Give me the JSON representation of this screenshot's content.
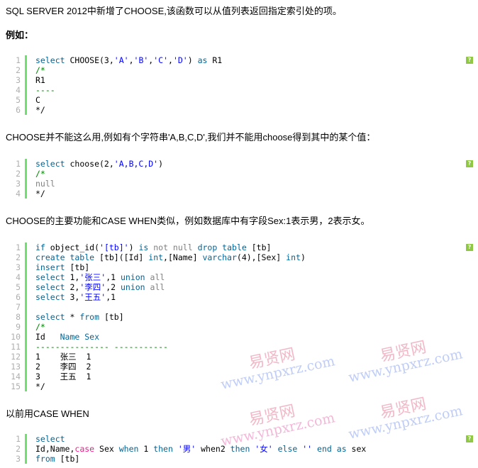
{
  "paragraphs": [
    "SQL SERVER 2012中新增了CHOOSE,该函数可以从值列表返回指定索引处的项。",
    "例如：",
    "CHOOSE并不能这么用,例如有个字符串'A,B,C,D',我们并不能用choose得到其中的某个值：",
    "CHOOSE的主要功能和CASE WHEN类似，例如数据库中有字段Sex:1表示男，2表示女。",
    "以前用CASE WHEN"
  ],
  "help_label": "?",
  "code_blocks": [
    [
      [
        [
          "select",
          "k"
        ],
        [
          " CHOOSE(3,",
          "n"
        ],
        [
          "'A'",
          "s"
        ],
        [
          ",",
          "n"
        ],
        [
          "'B'",
          "s"
        ],
        [
          ",",
          "n"
        ],
        [
          "'C'",
          "s"
        ],
        [
          ",",
          "n"
        ],
        [
          "'D'",
          "s"
        ],
        [
          ") ",
          "n"
        ],
        [
          "as",
          "k"
        ],
        [
          " R1",
          "n"
        ]
      ],
      [
        [
          "/*",
          "c"
        ]
      ],
      [
        [
          "R1",
          "n"
        ]
      ],
      [
        [
          "----",
          "c"
        ]
      ],
      [
        [
          "C",
          "n"
        ]
      ],
      [
        [
          "*/",
          "n"
        ]
      ]
    ],
    [
      [
        [
          "select",
          "k"
        ],
        [
          " choose(2,",
          "n"
        ],
        [
          "'A,B,C,D'",
          "s"
        ],
        [
          ")",
          "n"
        ]
      ],
      [
        [
          "/*",
          "c"
        ]
      ],
      [
        [
          "null",
          "g"
        ]
      ],
      [
        [
          "*/",
          "n"
        ]
      ]
    ],
    [
      [
        [
          "if",
          "k"
        ],
        [
          " object_id(",
          "n"
        ],
        [
          "'[tb]'",
          "s"
        ],
        [
          ") ",
          "n"
        ],
        [
          "is",
          "k"
        ],
        [
          " ",
          "n"
        ],
        [
          "not null",
          "g"
        ],
        [
          " ",
          "n"
        ],
        [
          "drop table",
          "k"
        ],
        [
          " [tb]",
          "n"
        ]
      ],
      [
        [
          "create table",
          "k"
        ],
        [
          " [tb]([Id] ",
          "n"
        ],
        [
          "int",
          "k"
        ],
        [
          ",[Name] ",
          "n"
        ],
        [
          "varchar",
          "k"
        ],
        [
          "(4),[Sex] ",
          "n"
        ],
        [
          "int",
          "k"
        ],
        [
          ")",
          "n"
        ]
      ],
      [
        [
          "insert",
          "k"
        ],
        [
          " [tb]",
          "n"
        ]
      ],
      [
        [
          "select",
          "k"
        ],
        [
          " 1,",
          "n"
        ],
        [
          "'张三'",
          "s"
        ],
        [
          ",1 ",
          "n"
        ],
        [
          "union",
          "k"
        ],
        [
          " ",
          "n"
        ],
        [
          "all",
          "g"
        ]
      ],
      [
        [
          "select",
          "k"
        ],
        [
          " 2,",
          "n"
        ],
        [
          "'李四'",
          "s"
        ],
        [
          ",2 ",
          "n"
        ],
        [
          "union",
          "k"
        ],
        [
          " ",
          "n"
        ],
        [
          "all",
          "g"
        ]
      ],
      [
        [
          "select",
          "k"
        ],
        [
          " 3,",
          "n"
        ],
        [
          "'王五'",
          "s"
        ],
        [
          ",1",
          "n"
        ]
      ],
      [],
      [
        [
          "select",
          "k"
        ],
        [
          " * ",
          "n"
        ],
        [
          "from",
          "k"
        ],
        [
          " [tb]",
          "n"
        ]
      ],
      [
        [
          "/*",
          "c"
        ]
      ],
      [
        [
          "Id   ",
          "n"
        ],
        [
          "Name Sex",
          "k"
        ]
      ],
      [
        [
          "--------------- -----------",
          "c"
        ]
      ],
      [
        [
          "1    张三  1",
          "n"
        ]
      ],
      [
        [
          "2    李四  2",
          "n"
        ]
      ],
      [
        [
          "3    王五  1",
          "n"
        ]
      ],
      [
        [
          "*/",
          "n"
        ]
      ]
    ],
    [
      [
        [
          "select",
          "k"
        ]
      ],
      [
        [
          "Id,Name,",
          "n"
        ],
        [
          "case",
          "f"
        ],
        [
          " Sex ",
          "n"
        ],
        [
          "when",
          "k"
        ],
        [
          " 1 ",
          "n"
        ],
        [
          "then",
          "k"
        ],
        [
          " ",
          "n"
        ],
        [
          "'男'",
          "s"
        ],
        [
          " when2 ",
          "n"
        ],
        [
          "then",
          "k"
        ],
        [
          " ",
          "n"
        ],
        [
          "'女'",
          "s"
        ],
        [
          " ",
          "n"
        ],
        [
          "else",
          "k"
        ],
        [
          " ",
          "n"
        ],
        [
          "''",
          "s"
        ],
        [
          " ",
          "n"
        ],
        [
          "end",
          "k"
        ],
        [
          " ",
          "n"
        ],
        [
          "as",
          "k"
        ],
        [
          " sex",
          "n"
        ]
      ],
      [
        [
          "from",
          "k"
        ],
        [
          " [tb]",
          "n"
        ]
      ]
    ]
  ],
  "watermark": {
    "cn": "易贤网",
    "url": "www.ynpxrz.com"
  }
}
